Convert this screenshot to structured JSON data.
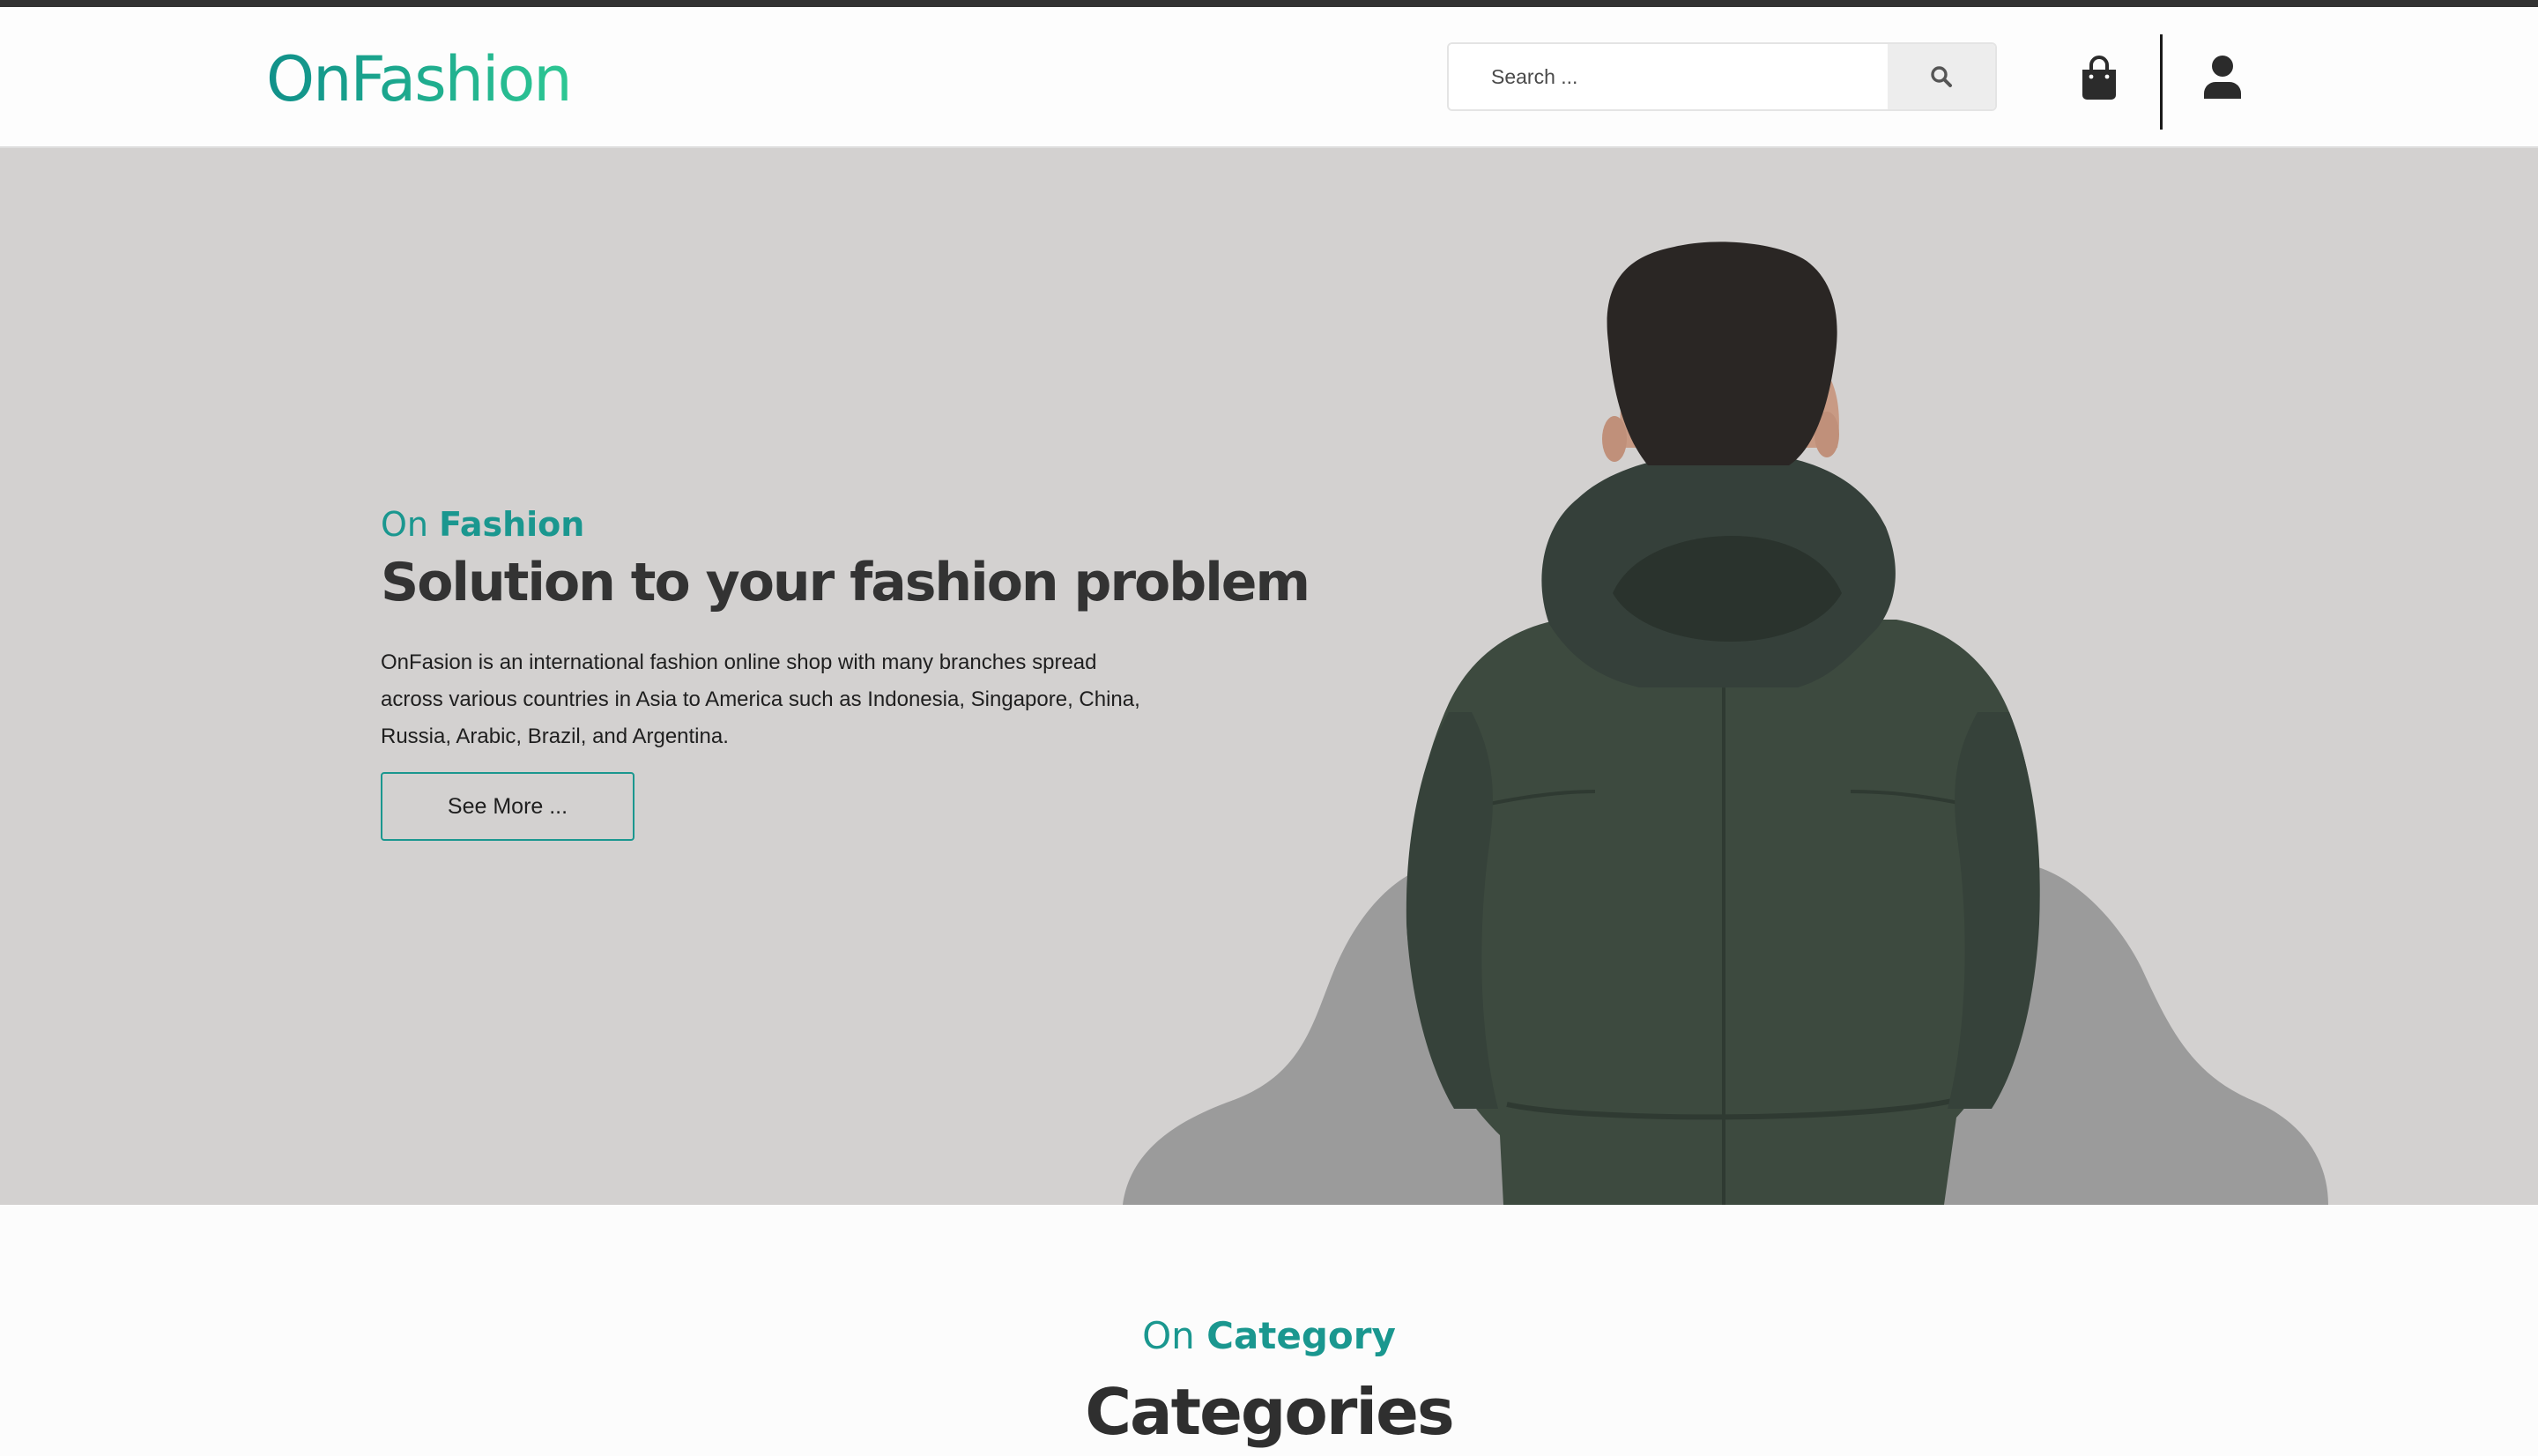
{
  "colors": {
    "accent": "#1a978f",
    "logo_gradient_start": "#10908a",
    "logo_gradient_end": "#2dc793",
    "hero_background": "#d3d1d0",
    "hero_blob": "#9b9b9b",
    "jacket": "#3d4a3f",
    "text_dark": "#333333"
  },
  "header": {
    "logo": "OnFashion",
    "search": {
      "placeholder": "Search ...",
      "value": "",
      "button_icon": "search-icon"
    },
    "cart_icon": "shopping-bag-icon",
    "account_icon": "user-icon"
  },
  "hero": {
    "eyebrow_light": "On",
    "eyebrow_strong": "Fashion",
    "title": "Solution to your fashion problem",
    "description": "OnFasion is an international fashion online shop with many branches spread across various countries in Asia to America such as Indonesia, Singapore, China, Russia, Arabic, Brazil, and Argentina.",
    "button_label": "See More ...",
    "image_icon": "man-in-hooded-jacket-photo"
  },
  "categories_section": {
    "eyebrow_light": "On",
    "eyebrow_strong": "Category",
    "title": "Categories"
  }
}
